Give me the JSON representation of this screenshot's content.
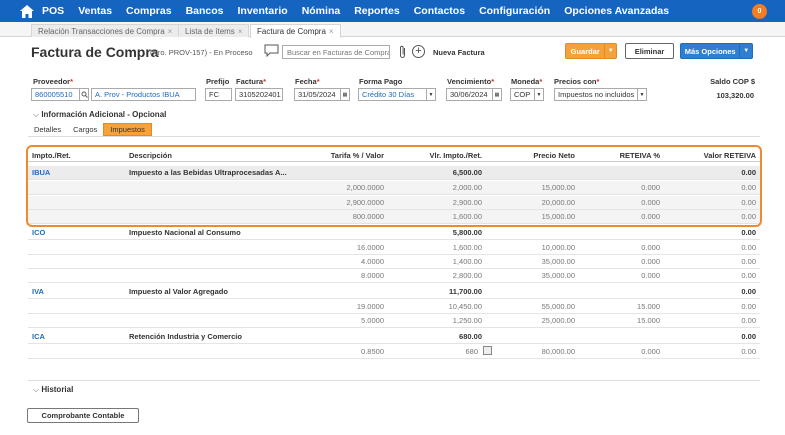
{
  "nav": {
    "items": [
      "POS",
      "Ventas",
      "Compras",
      "Bancos",
      "Inventario",
      "Nómina",
      "Reportes",
      "Contactos",
      "Configuración",
      "Opciones Avanzadas"
    ],
    "badge": "0"
  },
  "tabs": [
    {
      "label": "Relación Transacciones de Compra"
    },
    {
      "label": "Lista de ítems"
    },
    {
      "label": "Factura de Compra"
    }
  ],
  "header": {
    "title": "Factura de Compra",
    "subtitle": "(Nro. PROV-157) - En Proceso",
    "search_placeholder": "Buscar en Facturas de Compra",
    "new_label": "Nueva Factura",
    "save_label": "Guardar",
    "delete_label": "Eliminar",
    "more_label": "Más Opciones"
  },
  "form": {
    "proveedor_label": "Proveedor",
    "proveedor_id": "860005510",
    "proveedor_name": "A. Prov - Productos IBUA",
    "prefijo_label": "Prefijo",
    "prefijo": "FC",
    "factura_label": "Factura",
    "factura": "3105202401",
    "fecha_label": "Fecha",
    "fecha": "31/05/2024",
    "forma_pago_label": "Forma Pago",
    "forma_pago": "Crédito 30 Días",
    "vencimiento_label": "Vencimiento",
    "vencimiento": "30/06/2024",
    "moneda_label": "Moneda",
    "moneda": "COP",
    "precios_label": "Precios con",
    "precios": "Impuestos no incluidos",
    "saldo_label": "Saldo COP $",
    "saldo": "103,320.00"
  },
  "info_adicional": "Información Adicional - Opcional",
  "subtabs": [
    "Detalles",
    "Cargos",
    "Impuestos"
  ],
  "table": {
    "headers": [
      "Impto./Ret.",
      "Descripción",
      "Tarifa % / Valor",
      "Vlr. Impto./Ret.",
      "Precio Neto",
      "RETEIVA %",
      "Valor RETEIVA"
    ],
    "rows": [
      {
        "type": "group",
        "code": "IBUA",
        "desc": "Impuesto a las Bebidas Ultraprocesadas A...",
        "tarifa": "",
        "vlr": "6,500.00",
        "precio": "",
        "reteiva": "",
        "valor": "0.00"
      },
      {
        "type": "sub",
        "code": "",
        "desc": "",
        "tarifa": "2,000.0000",
        "vlr": "2,000.00",
        "precio": "15,000.00",
        "reteiva": "0.000",
        "valor": "0.00"
      },
      {
        "type": "sub",
        "code": "",
        "desc": "",
        "tarifa": "2,900.0000",
        "vlr": "2,900.00",
        "precio": "20,000.00",
        "reteiva": "0.000",
        "valor": "0.00"
      },
      {
        "type": "sub",
        "code": "",
        "desc": "",
        "tarifa": "800.0000",
        "vlr": "1,600.00",
        "precio": "15,000.00",
        "reteiva": "0.000",
        "valor": "0.00"
      },
      {
        "type": "group",
        "code": "ICO",
        "desc": "Impuesto Nacional al Consumo",
        "tarifa": "",
        "vlr": "5,800.00",
        "precio": "",
        "reteiva": "",
        "valor": "0.00"
      },
      {
        "type": "sub",
        "code": "",
        "desc": "",
        "tarifa": "16.0000",
        "vlr": "1,600.00",
        "precio": "10,000.00",
        "reteiva": "0.000",
        "valor": "0.00"
      },
      {
        "type": "sub",
        "code": "",
        "desc": "",
        "tarifa": "4.0000",
        "vlr": "1,400.00",
        "precio": "35,000.00",
        "reteiva": "0.000",
        "valor": "0.00"
      },
      {
        "type": "sub",
        "code": "",
        "desc": "",
        "tarifa": "8.0000",
        "vlr": "2,800.00",
        "precio": "35,000.00",
        "reteiva": "0.000",
        "valor": "0.00"
      },
      {
        "type": "group",
        "code": "IVA",
        "desc": "Impuesto al Valor Agregado",
        "tarifa": "",
        "vlr": "11,700.00",
        "precio": "",
        "reteiva": "",
        "valor": "0.00"
      },
      {
        "type": "sub",
        "code": "",
        "desc": "",
        "tarifa": "19.0000",
        "vlr": "10,450.00",
        "precio": "55,000.00",
        "reteiva": "15.000",
        "valor": "0.00"
      },
      {
        "type": "sub",
        "code": "",
        "desc": "",
        "tarifa": "5.0000",
        "vlr": "1,250.00",
        "precio": "25,000.00",
        "reteiva": "15.000",
        "valor": "0.00"
      },
      {
        "type": "group",
        "code": "ICA",
        "desc": "Retención Industria y Comercio",
        "tarifa": "",
        "vlr": "680.00",
        "precio": "",
        "reteiva": "",
        "valor": "0.00"
      },
      {
        "type": "sub",
        "code": "",
        "desc": "",
        "tarifa": "0.8500",
        "vlr": "680",
        "precio": "80,000.00",
        "reteiva": "0.000",
        "valor": "0.00"
      }
    ]
  },
  "historial": "Historial",
  "comprobante_label": "Comprobante Contable"
}
